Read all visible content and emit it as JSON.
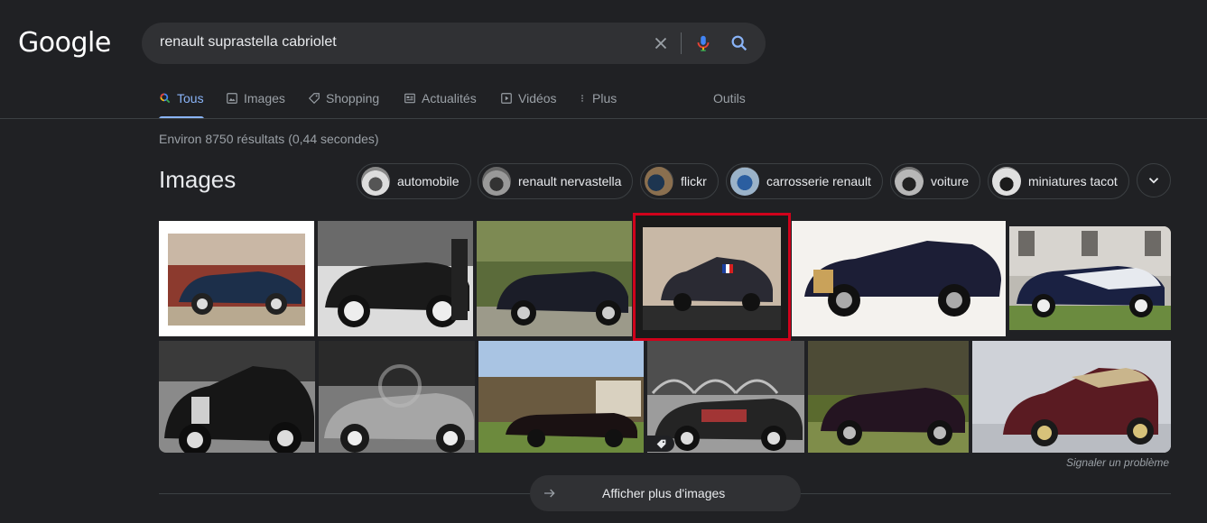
{
  "logo": "Google",
  "search": {
    "query": "renault suprastella cabriolet"
  },
  "tabs": [
    {
      "label": "Tous",
      "icon": "search-color-icon",
      "active": true
    },
    {
      "label": "Images",
      "icon": "image-icon"
    },
    {
      "label": "Shopping",
      "icon": "tag-icon"
    },
    {
      "label": "Actualités",
      "icon": "news-icon"
    },
    {
      "label": "Vidéos",
      "icon": "play-icon"
    },
    {
      "label": "Plus",
      "icon": "more-vert-icon"
    },
    {
      "label": "Outils"
    }
  ],
  "stats": "Environ 8750 résultats (0,44 secondes)",
  "images_section": {
    "heading": "Images",
    "chips": [
      "automobile",
      "renault nervastella",
      "flickr",
      "carrosserie renault",
      "voiture",
      "miniatures tacot"
    ],
    "report": "Signaler un problème",
    "more_label": "Afficher plus d'images"
  },
  "colors": {
    "accent": "#8ab4f8",
    "highlight": "#d0021b",
    "background": "#202124"
  }
}
